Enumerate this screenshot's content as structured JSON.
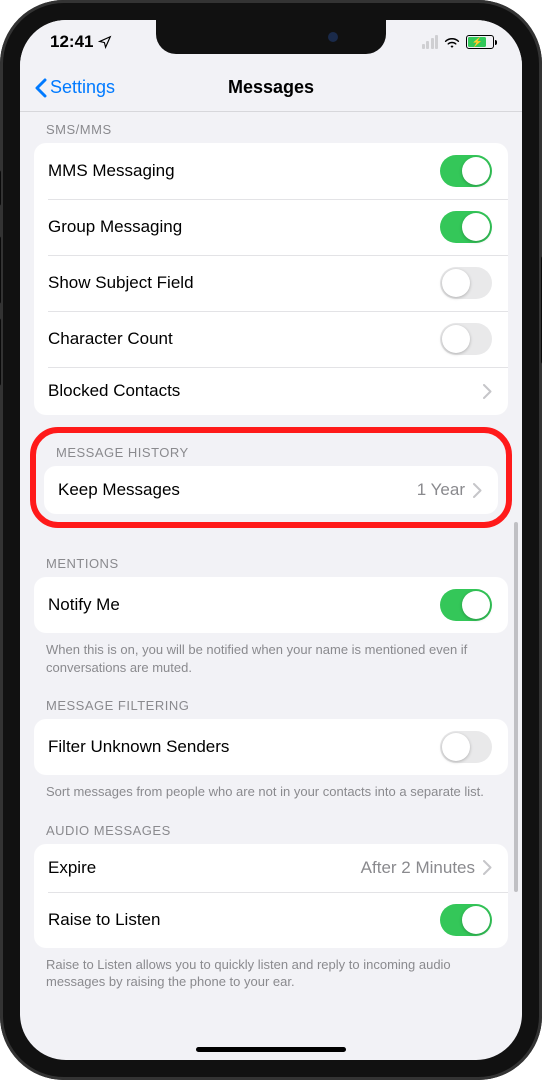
{
  "status": {
    "time": "12:41"
  },
  "nav": {
    "back": "Settings",
    "title": "Messages"
  },
  "sections": {
    "sms": {
      "header": "SMS/MMS",
      "rows": {
        "mms": "MMS Messaging",
        "group": "Group Messaging",
        "subject": "Show Subject Field",
        "charcount": "Character Count",
        "blocked": "Blocked Contacts"
      }
    },
    "history": {
      "header": "MESSAGE HISTORY",
      "keep_label": "Keep Messages",
      "keep_value": "1 Year"
    },
    "mentions": {
      "header": "MENTIONS",
      "notify": "Notify Me",
      "footer": "When this is on, you will be notified when your name is mentioned even if conversations are muted."
    },
    "filtering": {
      "header": "MESSAGE FILTERING",
      "filter": "Filter Unknown Senders",
      "footer": "Sort messages from people who are not in your contacts into a separate list."
    },
    "audio": {
      "header": "AUDIO MESSAGES",
      "expire_label": "Expire",
      "expire_value": "After 2 Minutes",
      "raise": "Raise to Listen",
      "footer": "Raise to Listen allows you to quickly listen and reply to incoming audio messages by raising the phone to your ear."
    }
  }
}
